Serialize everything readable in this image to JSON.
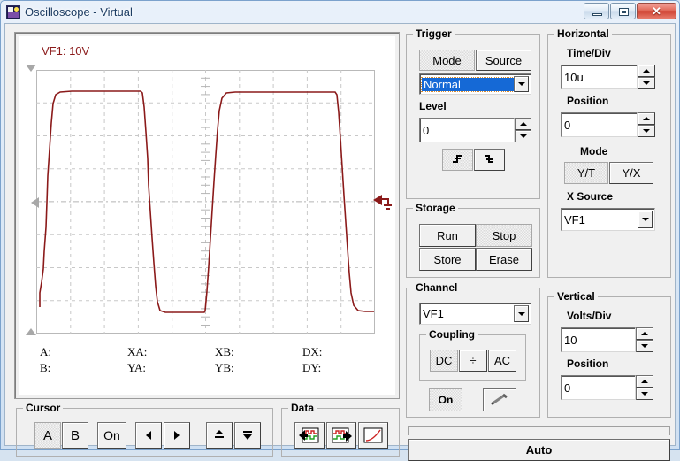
{
  "window": {
    "title": "Oscilloscope - Virtual",
    "icon": "oscilloscope-icon",
    "minimize": "minimize-icon",
    "maximize": "maximize-icon",
    "close": "✕"
  },
  "plot": {
    "channel_label": "VF1: 10V",
    "trace_color": "#8b1a1a",
    "grid_color": "#c8c8c8",
    "background": "#ffffff"
  },
  "readout": {
    "rows": [
      [
        "A:",
        "XA:",
        "XB:",
        "DX:"
      ],
      [
        "B:",
        "YA:",
        "YB:",
        "DY:"
      ]
    ]
  },
  "trigger": {
    "legend": "Trigger",
    "mode_button": "Mode",
    "source_button": "Source",
    "mode_value": "Normal",
    "level_label": "Level",
    "level_value": "0",
    "edge_rising": "rising-edge-icon",
    "edge_falling": "falling-edge-icon"
  },
  "storage": {
    "legend": "Storage",
    "run": "Run",
    "stop": "Stop",
    "store": "Store",
    "erase": "Erase"
  },
  "channel": {
    "legend": "Channel",
    "source_value": "VF1",
    "coupling_legend": "Coupling",
    "dc": "DC",
    "gnd": "÷",
    "ac": "AC",
    "on": "On",
    "probe": "probe-icon"
  },
  "horizontal": {
    "legend": "Horizontal",
    "timediv_label": "Time/Div",
    "timediv_value": "10u",
    "position_label": "Position",
    "position_value": "0",
    "mode_label": "Mode",
    "mode_yt": "Y/T",
    "mode_yx": "Y/X",
    "xsource_label": "X Source",
    "xsource_value": "VF1"
  },
  "vertical": {
    "legend": "Vertical",
    "voltsdiv_label": "Volts/Div",
    "voltsdiv_value": "10",
    "position_label": "Position",
    "position_value": "0"
  },
  "cursor": {
    "legend": "Cursor",
    "a": "A",
    "b": "B",
    "on": "On",
    "left": "left-arrow-icon",
    "right": "right-arrow-icon",
    "up": "up-arrow-icon",
    "down": "down-arrow-icon"
  },
  "data_panel": {
    "legend": "Data",
    "import": "import-waveform-icon",
    "export": "export-waveform-icon",
    "curve": "curve-icon"
  },
  "footer": {
    "auto": "Auto"
  },
  "chart_data": {
    "type": "line",
    "title": "VF1: 10V",
    "xlabel": "",
    "ylabel": "",
    "grid": true,
    "legend": "none",
    "x_divisions": 10,
    "y_divisions": 8,
    "volts_per_div": 10,
    "time_per_div": "10u",
    "series": [
      {
        "name": "VF1",
        "color": "#8b1a1a",
        "points": [
          [
            0.0,
            -3.2
          ],
          [
            0.2,
            3.6
          ],
          [
            1.0,
            3.6
          ],
          [
            1.2,
            -3.3
          ],
          [
            4.1,
            -3.3
          ],
          [
            4.3,
            3.5
          ],
          [
            7.2,
            3.5
          ],
          [
            7.4,
            -3.3
          ],
          [
            10.0,
            -3.3
          ]
        ]
      }
    ]
  }
}
